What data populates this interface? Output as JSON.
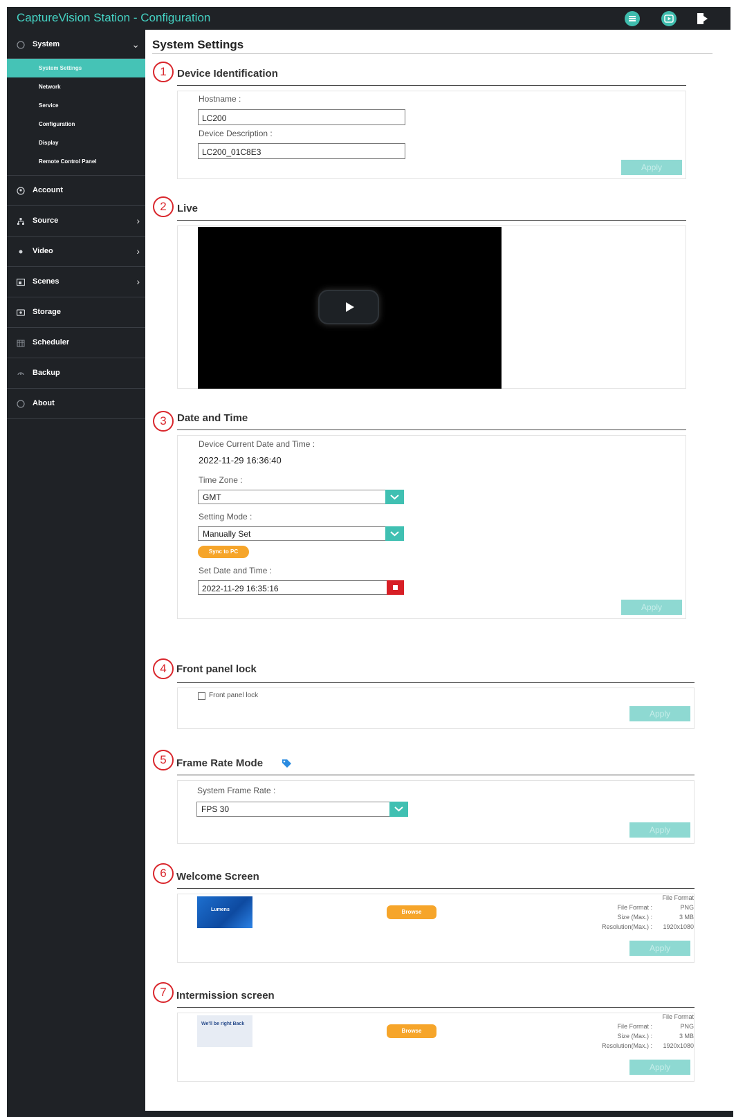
{
  "app": {
    "title": "CaptureVision Station - Configuration"
  },
  "header_icons": [
    "menu-icon",
    "play-icon",
    "logout-icon"
  ],
  "sidebar": {
    "items": [
      {
        "label": "System",
        "icon": "globe-icon",
        "expanded": true,
        "children": [
          "System Settings",
          "Network",
          "Service",
          "Configuration",
          "Display",
          "Remote Control Panel"
        ],
        "active_child": "System Settings"
      },
      {
        "label": "Account",
        "icon": "user-icon"
      },
      {
        "label": "Source",
        "icon": "source-icon",
        "has_submenu": true
      },
      {
        "label": "Video",
        "icon": "video-icon",
        "has_submenu": true
      },
      {
        "label": "Scenes",
        "icon": "scenes-icon",
        "has_submenu": true
      },
      {
        "label": "Storage",
        "icon": "storage-icon"
      },
      {
        "label": "Scheduler",
        "icon": "calendar-icon"
      },
      {
        "label": "Backup",
        "icon": "backup-icon"
      },
      {
        "label": "About",
        "icon": "info-icon"
      }
    ]
  },
  "page": {
    "title": "System Settings"
  },
  "sections": {
    "device_identification": {
      "marker": "1",
      "title": "Device Identification",
      "hostname_label": "Hostname :",
      "hostname_value": "LC200",
      "description_label": "Device Description :",
      "description_value": "LC200_01C8E3",
      "apply": "Apply"
    },
    "live": {
      "marker": "2",
      "title": "Live"
    },
    "date_time": {
      "marker": "3",
      "title": "Date and Time",
      "current_label": "Device Current Date and Time :",
      "current_value": "2022-11-29 16:36:40",
      "timezone_label": "Time Zone :",
      "timezone_value": "GMT",
      "mode_label": "Setting Mode :",
      "mode_value": "Manually Set",
      "sync_button": "Sync to PC",
      "set_label": "Set Date and Time :",
      "set_value": "2022-11-29 16:35:16",
      "apply": "Apply"
    },
    "front_panel_lock": {
      "marker": "4",
      "title": "Front panel lock",
      "checkbox_label": "Front panel lock",
      "checked": false,
      "apply": "Apply"
    },
    "frame_rate": {
      "marker": "5",
      "title": "Frame Rate Mode",
      "rate_label": "System Frame Rate :",
      "rate_value": "FPS 30",
      "apply": "Apply"
    },
    "welcome_screen": {
      "marker": "6",
      "title": "Welcome Screen",
      "thumb_text": "Lumens",
      "browse": "Browse",
      "format_heading": "File Format",
      "format_label": "File Format :",
      "format_value": "PNG",
      "size_label": "Size (Max.) :",
      "size_value": "3 MB",
      "res_label": "Resolution(Max.) :",
      "res_value": "1920x1080",
      "apply": "Apply"
    },
    "intermission_screen": {
      "marker": "7",
      "title": "Intermission screen",
      "thumb_text": "We'll be right Back",
      "browse": "Browse",
      "format_heading": "File Format",
      "format_label": "File Format :",
      "format_value": "PNG",
      "size_label": "Size (Max.) :",
      "size_value": "3 MB",
      "res_label": "Resolution(Max.) :",
      "res_value": "1920x1080",
      "apply": "Apply"
    }
  },
  "colors": {
    "accent": "#45c3b6",
    "sidebar_bg": "#1f2226",
    "marker": "#d9262c",
    "browse": "#f6a52a",
    "apply": "#8ed9d2"
  }
}
